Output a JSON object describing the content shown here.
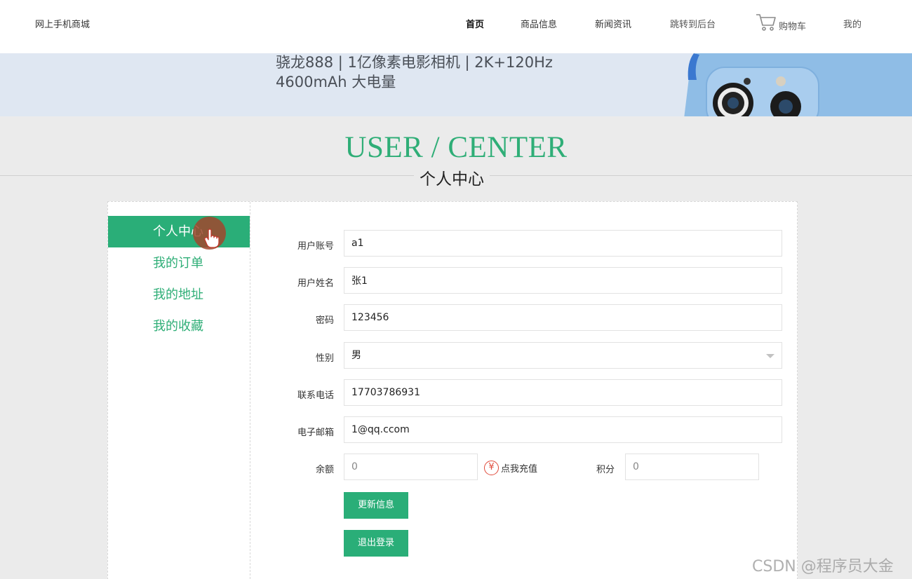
{
  "header": {
    "brand": "网上手机商城",
    "nav": {
      "home": "首页",
      "products": "商品信息",
      "news": "新闻资讯",
      "admin": "跳转到后台",
      "cart": "购物车",
      "mine": "我的"
    }
  },
  "banner": {
    "line1": "骁龙888 | 1亿像素电影相机 | 2K+120Hz",
    "line2": "4600mAh 大电量"
  },
  "section": {
    "title_en": "USER / CENTER",
    "title_cn": "个人中心"
  },
  "sidebar": {
    "items": [
      {
        "label": "个人中心"
      },
      {
        "label": "我的订单"
      },
      {
        "label": "我的地址"
      },
      {
        "label": "我的收藏"
      }
    ]
  },
  "form": {
    "account_label": "用户账号",
    "account_value": "a1",
    "name_label": "用户姓名",
    "name_value": "张1",
    "password_label": "密码",
    "password_value": "123456",
    "gender_label": "性别",
    "gender_value": "男",
    "phone_label": "联系电话",
    "phone_value": "17703786931",
    "email_label": "电子邮箱",
    "email_value": "1@qq.ccom",
    "balance_label": "余额",
    "balance_value": "0",
    "recharge_label": "点我充值",
    "points_label": "积分",
    "points_value": "0",
    "update_button": "更新信息",
    "logout_button": "退出登录"
  },
  "watermark": "CSDN @程序员大金",
  "colors": {
    "accent": "#2aae78",
    "heading": "#2fae77",
    "recharge_icon": "#e04a3a"
  },
  "icons": {
    "cart": "shopping-cart-icon",
    "recharge": "yen-icon",
    "cursor": "hand-pointer-icon",
    "gender_select": "chevron-down-icon"
  }
}
